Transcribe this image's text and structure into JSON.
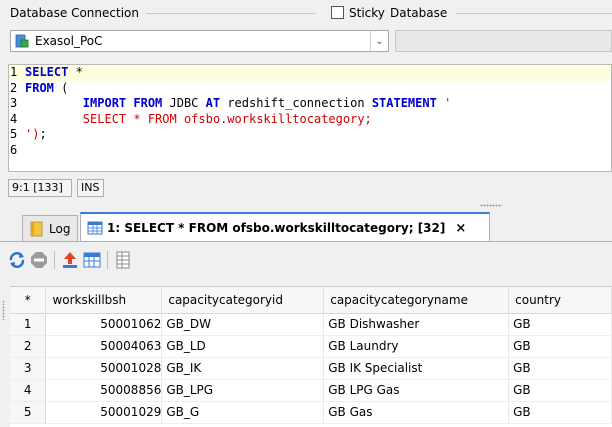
{
  "connection": {
    "section_label": "Database Connection",
    "selected": "Exasol_PoC",
    "sticky_label": "Sticky",
    "database_label": "Database",
    "database_value": ""
  },
  "editor": {
    "lines": [
      {
        "n": "1",
        "tokens": [
          {
            "t": "SELECT",
            "c": "kw"
          },
          {
            "t": " *",
            "c": ""
          }
        ]
      },
      {
        "n": "2",
        "tokens": [
          {
            "t": "FROM",
            "c": "kw"
          },
          {
            "t": " (",
            "c": ""
          }
        ]
      },
      {
        "n": "3",
        "tokens": [
          {
            "t": "        ",
            "c": ""
          },
          {
            "t": "IMPORT FROM",
            "c": "kw"
          },
          {
            "t": " JDBC ",
            "c": ""
          },
          {
            "t": "AT",
            "c": "kw"
          },
          {
            "t": " redshift_connection ",
            "c": ""
          },
          {
            "t": "STATEMENT",
            "c": "kw"
          },
          {
            "t": " '",
            "c": "str"
          }
        ]
      },
      {
        "n": "4",
        "tokens": [
          {
            "t": "        SELECT * FROM ofsbo.workskilltocategory;",
            "c": "str"
          }
        ]
      },
      {
        "n": "5",
        "tokens": [
          {
            "t": "')",
            "c": "str"
          },
          {
            "t": ";",
            "c": ""
          }
        ]
      },
      {
        "n": "6",
        "tokens": []
      }
    ]
  },
  "status": {
    "position": "9:1 [133]",
    "mode": "INS"
  },
  "tabs": {
    "log_label": "Log",
    "result_label": "1: SELECT * FROM ofsbo.workskilltocategory; [32]",
    "close_glyph": "×"
  },
  "grid": {
    "columns": [
      "*",
      "workskillbsh",
      "capacitycategoryid",
      "capacitycategoryname",
      "country"
    ],
    "rows": [
      [
        "1",
        "50001062",
        "GB_DW",
        "GB Dishwasher",
        "GB"
      ],
      [
        "2",
        "50004063",
        "GB_LD",
        "GB Laundry",
        "GB"
      ],
      [
        "3",
        "50001028",
        "GB_IK",
        "GB IK Specialist",
        "GB"
      ],
      [
        "4",
        "50008856",
        "GB_LPG",
        "GB LPG Gas",
        "GB"
      ],
      [
        "5",
        "50001029",
        "GB_G",
        "GB Gas",
        "GB"
      ]
    ]
  },
  "colors": {
    "keyword": "#0000cc",
    "string": "#d00000",
    "tab_accent": "#3a7bd5"
  }
}
